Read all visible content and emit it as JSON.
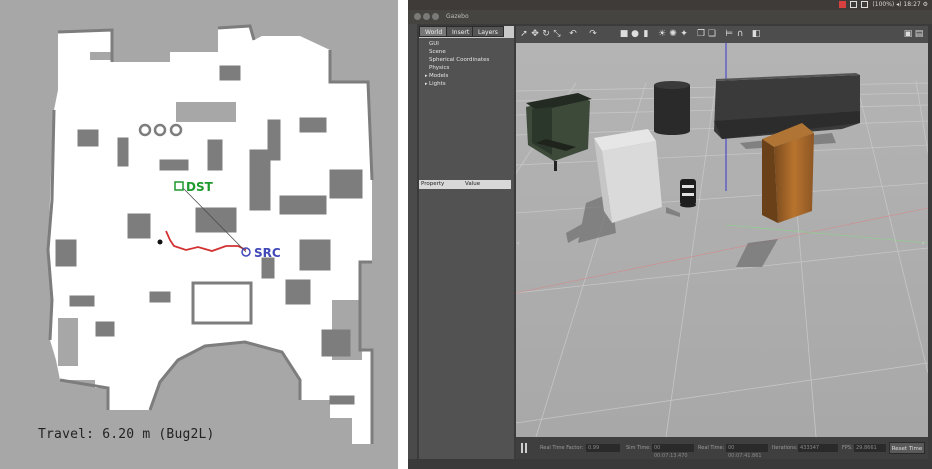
{
  "map": {
    "dst_label": "DST",
    "src_label": "SRC",
    "travel_caption": "Travel: 6.20 m (Bug2L)",
    "colors": {
      "free": "#ffffff",
      "unknown": "#a7a7a7",
      "obstacle": "#7d7d7d",
      "path": "#d23232",
      "dst": "#1f9a2e",
      "src": "#4048b8"
    }
  },
  "gazebo": {
    "window_title": "Gazebo",
    "tray_text": "(100%)  ◂)  18:27  ⚙",
    "tabs": [
      "World",
      "Insert",
      "Layers"
    ],
    "tree_items": [
      {
        "label": "GUI",
        "arrow": ""
      },
      {
        "label": "Scene",
        "arrow": ""
      },
      {
        "label": "Spherical Coordinates",
        "arrow": ""
      },
      {
        "label": "Physics",
        "arrow": ""
      },
      {
        "label": "Models",
        "arrow": "▸"
      },
      {
        "label": "Lights",
        "arrow": "▸"
      }
    ],
    "property_header": {
      "property": "Property",
      "value": "Value"
    },
    "toolbar_icons": [
      "select-arrow-icon",
      "translate-icon",
      "rotate-icon",
      "scale-icon",
      "undo-icon",
      "redo-icon",
      "box-icon",
      "sphere-icon",
      "cylinder-icon",
      "sun-light-icon",
      "point-light-icon",
      "spot-light-icon",
      "copy-icon",
      "paste-icon",
      "align-icon",
      "snap-icon",
      "change-view-icon",
      "screenshot-icon",
      "record-icon"
    ],
    "status": {
      "real_time_factor_label": "Real Time Factor:",
      "real_time_factor_value": "0.99",
      "sim_time_label": "Sim Time:",
      "sim_time_value": "00 00:07:13.470",
      "real_time_label": "Real Time:",
      "real_time_value": "00 00:07:41.861",
      "iterations_label": "Iterations:",
      "iterations_value": "433347",
      "fps_label": "FPS:",
      "fps_value": "29.8661",
      "reset_label": "Reset Time"
    }
  }
}
